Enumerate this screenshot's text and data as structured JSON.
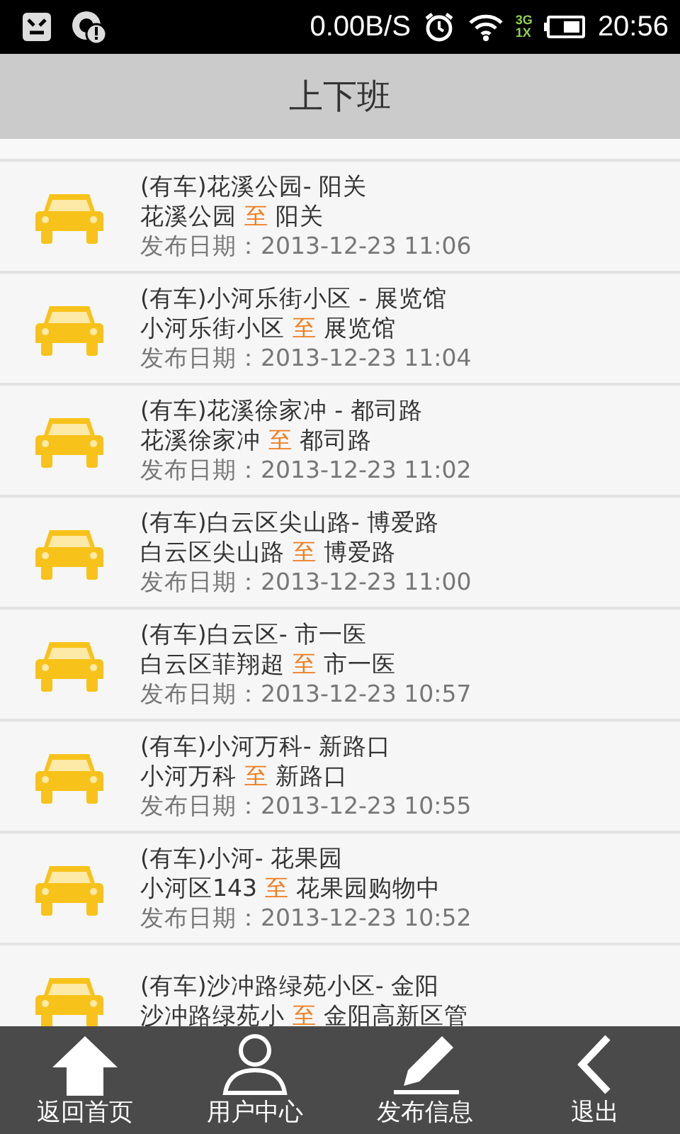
{
  "status_bar": {
    "speed": "0.00B/S",
    "network_top": "3G",
    "network_bottom": "1X",
    "time": "20:56"
  },
  "title_bar": {
    "title": "上下班"
  },
  "rides": [
    {
      "title": "(有车)花溪公园- 阳关",
      "from": "花溪公园",
      "connector": "至",
      "to": "阳关",
      "date": "发布日期：2013-12-23 11:06"
    },
    {
      "title": "(有车)小河乐街小区 - 展览馆",
      "from": "小河乐街小区",
      "connector": "至",
      "to": "展览馆",
      "date": "发布日期：2013-12-23 11:04"
    },
    {
      "title": "(有车)花溪徐家冲 - 都司路",
      "from": "花溪徐家冲",
      "connector": "至",
      "to": "都司路",
      "date": "发布日期：2013-12-23 11:02"
    },
    {
      "title": "(有车)白云区尖山路- 博爱路",
      "from": "白云区尖山路",
      "connector": "至",
      "to": "博爱路",
      "date": "发布日期：2013-12-23 11:00"
    },
    {
      "title": "(有车)白云区- 市一医",
      "from": "白云区菲翔超",
      "connector": "至",
      "to": "市一医",
      "date": "发布日期：2013-12-23 10:57"
    },
    {
      "title": "(有车)小河万科- 新路口",
      "from": "小河万科",
      "connector": "至",
      "to": "新路口",
      "date": "发布日期：2013-12-23 10:55"
    },
    {
      "title": "(有车)小河- 花果园",
      "from": "小河区143",
      "connector": "至",
      "to": "花果园购物中",
      "date": "发布日期：2013-12-23 10:52"
    },
    {
      "title": "(有车)沙冲路绿苑小区- 金阳",
      "from": "沙冲路绿苑小",
      "connector": "至",
      "to": "金阳高新区管"
    }
  ],
  "bottom_nav": [
    {
      "kind": "home",
      "label": "返回首页"
    },
    {
      "kind": "user",
      "label": "用户中心"
    },
    {
      "kind": "edit",
      "label": "发布信息"
    },
    {
      "kind": "back",
      "label": "退出"
    }
  ]
}
